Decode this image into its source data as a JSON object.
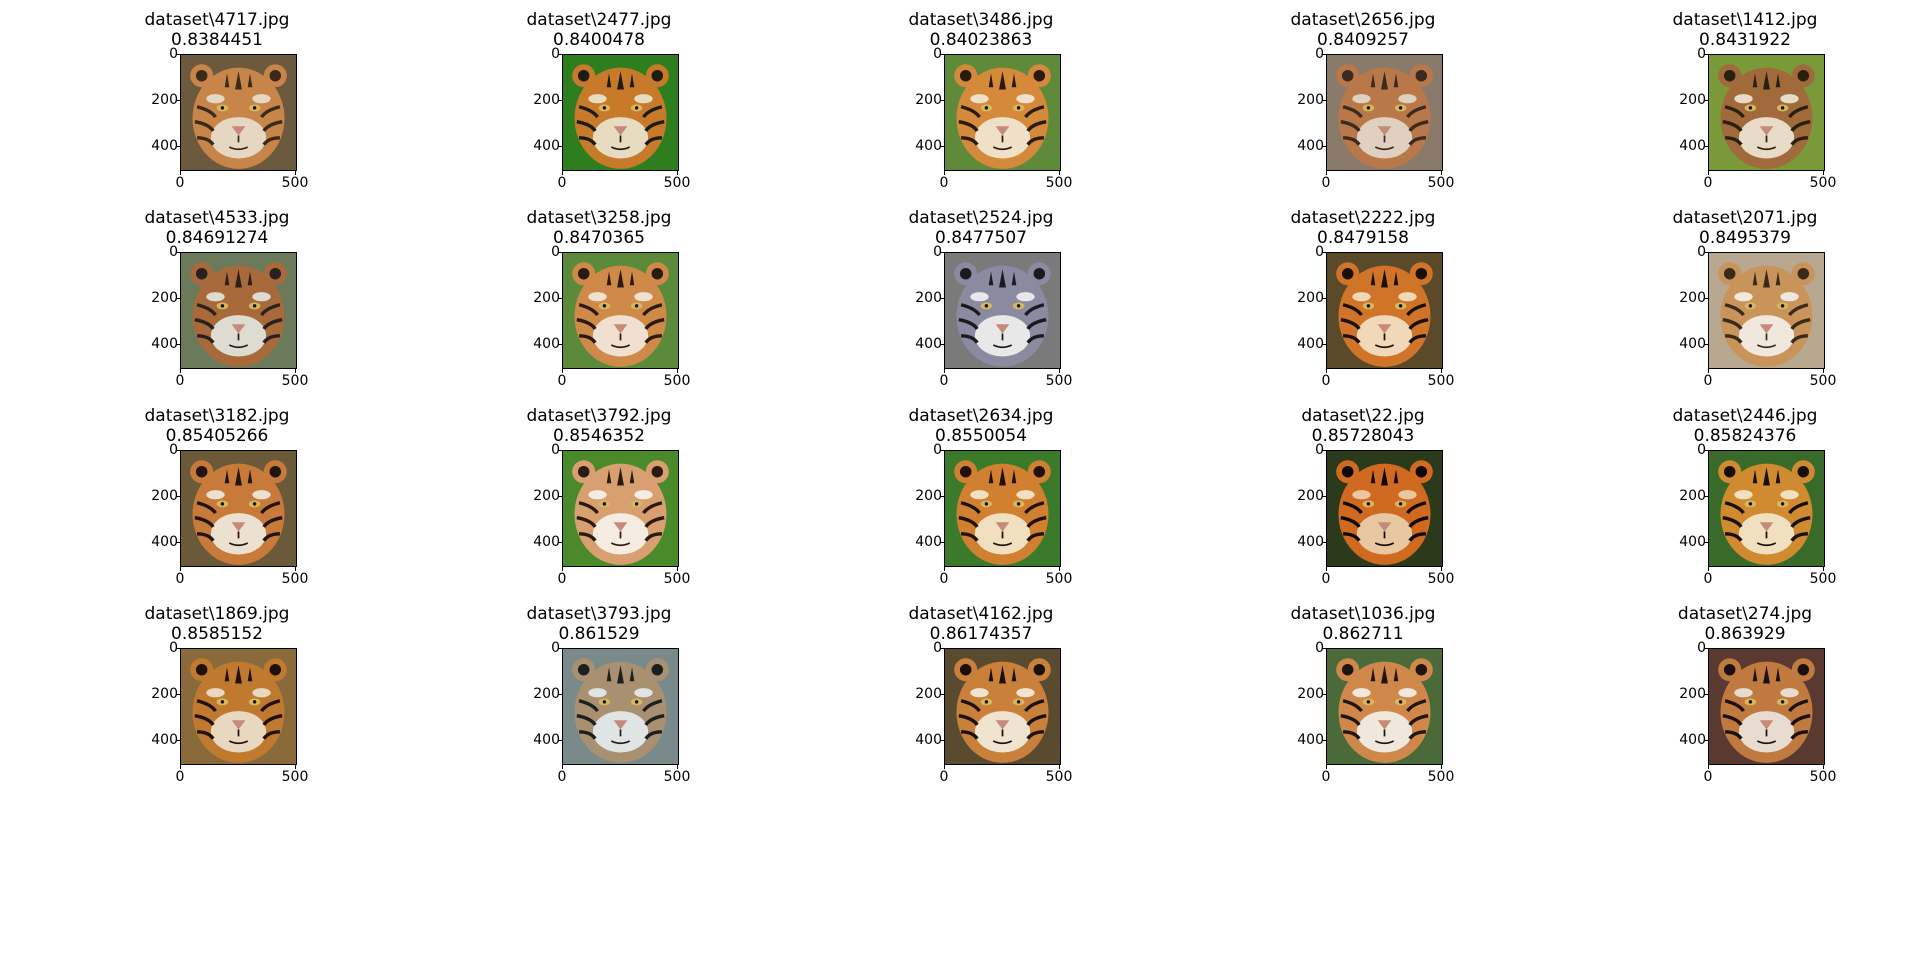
{
  "ticks": {
    "y": [
      "0",
      "200",
      "400"
    ],
    "x": [
      "0",
      "500"
    ]
  },
  "panels": [
    {
      "name": "dataset\\4717.jpg",
      "score": "0.8384451",
      "image": "tiger-photo",
      "palette": [
        "#6b5a3e",
        "#c7854a",
        "#3b2a1a",
        "#e6d7c3"
      ]
    },
    {
      "name": "dataset\\2477.jpg",
      "score": "0.8400478",
      "image": "tiger-photo",
      "palette": [
        "#2e7d1f",
        "#c77a2a",
        "#1c1c10",
        "#e8dcc0"
      ]
    },
    {
      "name": "dataset\\3486.jpg",
      "score": "0.84023863",
      "image": "tiger-photo",
      "palette": [
        "#5e8a3a",
        "#d48a3a",
        "#2a1a10",
        "#f0e0c8"
      ]
    },
    {
      "name": "dataset\\2656.jpg",
      "score": "0.8409257",
      "image": "tiger-photo",
      "palette": [
        "#8a7a6a",
        "#b8784a",
        "#3a2a20",
        "#e0d0c0"
      ]
    },
    {
      "name": "dataset\\1412.jpg",
      "score": "0.8431922",
      "image": "tiger-photo",
      "palette": [
        "#7a9a3a",
        "#a06a3a",
        "#2a2010",
        "#e8dcc8"
      ]
    },
    {
      "name": "dataset\\4533.jpg",
      "score": "0.84691274",
      "image": "tiger-photo",
      "palette": [
        "#6a7a5a",
        "#a86a3a",
        "#2a2020",
        "#dcdcd0"
      ]
    },
    {
      "name": "dataset\\3258.jpg",
      "score": "0.8470365",
      "image": "tiger-photo",
      "palette": [
        "#5a8a3a",
        "#cf8a4a",
        "#2a1a10",
        "#f0e0d0"
      ]
    },
    {
      "name": "dataset\\2524.jpg",
      "score": "0.8477507",
      "image": "tiger-photo",
      "palette": [
        "#7a7a7a",
        "#8a8aa0",
        "#1a1a20",
        "#e8e8e8"
      ]
    },
    {
      "name": "dataset\\2222.jpg",
      "score": "0.8479158",
      "image": "tiger-photo",
      "palette": [
        "#5a4a2a",
        "#d0742a",
        "#1a1008",
        "#f0d8b8"
      ]
    },
    {
      "name": "dataset\\2071.jpg",
      "score": "0.8495379",
      "image": "tiger-photo",
      "palette": [
        "#b8a890",
        "#c8945a",
        "#3a2a1a",
        "#f0e8dc"
      ]
    },
    {
      "name": "dataset\\3182.jpg",
      "score": "0.85405266",
      "image": "tiger-photo",
      "palette": [
        "#6a5a3a",
        "#c87a3a",
        "#201510",
        "#ece0d0"
      ]
    },
    {
      "name": "dataset\\3792.jpg",
      "score": "0.8546352",
      "image": "tiger-photo",
      "palette": [
        "#4a8a2a",
        "#d8a070",
        "#2a1a10",
        "#f4ece0"
      ]
    },
    {
      "name": "dataset\\2634.jpg",
      "score": "0.8550054",
      "image": "tiger-photo",
      "palette": [
        "#3a7a2a",
        "#d08030",
        "#201008",
        "#f0e0c0"
      ]
    },
    {
      "name": "dataset\\22.jpg",
      "score": "0.85728043",
      "image": "tiger-photo",
      "palette": [
        "#2a3a1a",
        "#d06a20",
        "#100808",
        "#e8c8a0"
      ]
    },
    {
      "name": "dataset\\2446.jpg",
      "score": "0.85824376",
      "image": "tiger-photo",
      "palette": [
        "#3a6a2a",
        "#d08a30",
        "#181008",
        "#f0e0c0"
      ]
    },
    {
      "name": "dataset\\1869.jpg",
      "score": "0.8585152",
      "image": "tiger-photo",
      "palette": [
        "#8a6a3a",
        "#c07a30",
        "#201008",
        "#e8d8c0"
      ]
    },
    {
      "name": "dataset\\3793.jpg",
      "score": "0.861529",
      "image": "tiger-photo",
      "palette": [
        "#7a8a8a",
        "#a89070",
        "#1a2020",
        "#e0e4e4"
      ]
    },
    {
      "name": "dataset\\4162.jpg",
      "score": "0.86174357",
      "image": "tiger-photo",
      "palette": [
        "#5a4a30",
        "#c8803a",
        "#1a1008",
        "#f0e4d0"
      ]
    },
    {
      "name": "dataset\\1036.jpg",
      "score": "0.862711",
      "image": "tiger-photo",
      "palette": [
        "#4a6a3a",
        "#d0884a",
        "#201510",
        "#f0e8dc"
      ]
    },
    {
      "name": "dataset\\274.jpg",
      "score": "0.863929",
      "image": "tiger-photo",
      "palette": [
        "#5a3a30",
        "#c07a40",
        "#1a1010",
        "#e8dcd0"
      ]
    }
  ]
}
